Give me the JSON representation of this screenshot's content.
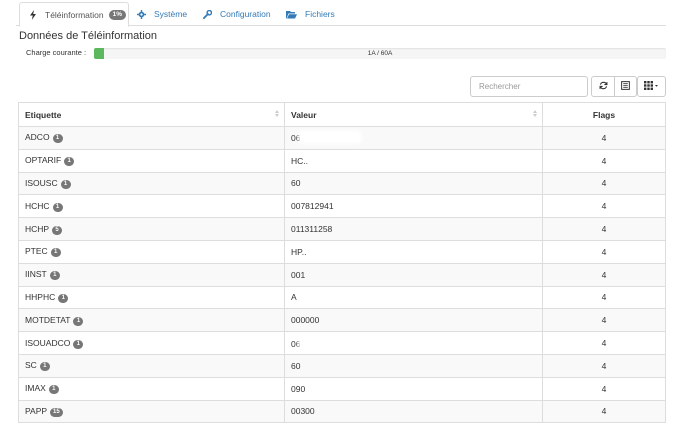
{
  "tabs": [
    {
      "label": "Téléinformation",
      "badge": "1%",
      "icon": "bolt-icon"
    },
    {
      "label": "Système",
      "icon": "gear-icon"
    },
    {
      "label": "Configuration",
      "icon": "wrench-icon"
    },
    {
      "label": "Fichiers",
      "icon": "folder-open-icon"
    }
  ],
  "section_title": "Données de Téléinformation",
  "charge": {
    "label": "Charge courante :",
    "text": "1A / 60A",
    "fraction": 0.0167,
    "color": "#5cb85c"
  },
  "search": {
    "placeholder": "Rechercher"
  },
  "toolbar": {
    "refresh_icon": "refresh-icon",
    "toggle_icon": "list-icon",
    "columns_icon": "grid-icon"
  },
  "table": {
    "headers": [
      "Etiquette",
      "Valeur",
      "Flags"
    ],
    "rows": [
      {
        "label": "ADCO",
        "badge": "1",
        "value": "06",
        "redacted": true,
        "flags": "4"
      },
      {
        "label": "OPTARIF",
        "badge": "1",
        "value": "HC..",
        "redacted": false,
        "flags": "4"
      },
      {
        "label": "ISOUSC",
        "badge": "1",
        "value": "60",
        "redacted": false,
        "flags": "4"
      },
      {
        "label": "HCHC",
        "badge": "1",
        "value": "007812941",
        "redacted": false,
        "flags": "4"
      },
      {
        "label": "HCHP",
        "badge": "5",
        "value": "011311258",
        "redacted": false,
        "flags": "4"
      },
      {
        "label": "PTEC",
        "badge": "1",
        "value": "HP..",
        "redacted": false,
        "flags": "4"
      },
      {
        "label": "IINST",
        "badge": "1",
        "value": "001",
        "redacted": false,
        "flags": "4"
      },
      {
        "label": "HHPHC",
        "badge": "1",
        "value": "A",
        "redacted": false,
        "flags": "4"
      },
      {
        "label": "MOTDETAT",
        "badge": "1",
        "value": "000000",
        "redacted": false,
        "flags": "4"
      },
      {
        "label": "ISOUADCO",
        "badge": "1",
        "value": "06",
        "redacted": true,
        "flags": "4"
      },
      {
        "label": "SC",
        "badge": "1",
        "value": "60",
        "redacted": false,
        "flags": "4"
      },
      {
        "label": "IMAX",
        "badge": "1",
        "value": "090",
        "redacted": false,
        "flags": "4"
      },
      {
        "label": "PAPP",
        "badge": "15",
        "value": "00300",
        "redacted": false,
        "flags": "4"
      }
    ]
  }
}
